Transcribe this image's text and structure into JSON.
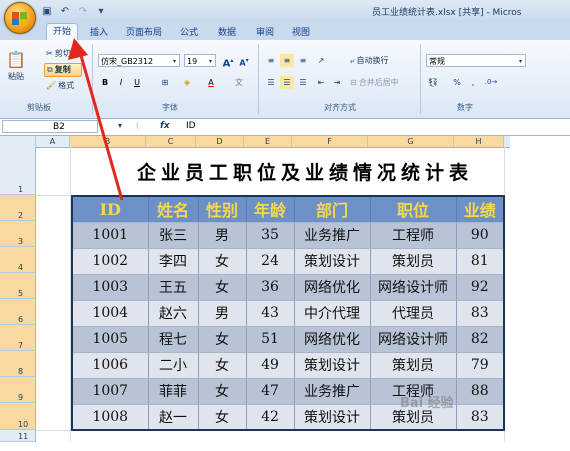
{
  "window": {
    "title": "员工业绩统计表.xlsx [共享] - Micros"
  },
  "tabs": [
    "开始",
    "插入",
    "页面布局",
    "公式",
    "数据",
    "审阅",
    "视图"
  ],
  "ribbon": {
    "clipboard": {
      "paste": "粘贴",
      "cut": "剪切",
      "copy": "复制",
      "format_painter": "格式",
      "group_label": "剪贴板"
    },
    "font": {
      "font_name": "仿宋_GB2312",
      "font_size": "19",
      "grow": "A",
      "shrink": "A",
      "bold": "B",
      "italic": "I",
      "underline": "U",
      "group_label": "字体"
    },
    "alignment": {
      "wrap_text": "自动换行",
      "merge_center": "合并后居中",
      "group_label": "对齐方式"
    },
    "number": {
      "format": "常规",
      "percent": "%",
      "comma": ",",
      "group_label": "数字"
    }
  },
  "formula_bar": {
    "name_box": "B2",
    "fx": "fx",
    "content": "ID"
  },
  "columns": [
    "A",
    "B",
    "C",
    "D",
    "E",
    "F",
    "G",
    "H"
  ],
  "rows": [
    "1",
    "2",
    "3",
    "4",
    "5",
    "6",
    "7",
    "8",
    "9",
    "10",
    "11"
  ],
  "sheet": {
    "title": "企业员工职位及业绩情况统计表",
    "headers": [
      "ID",
      "姓名",
      "性别",
      "年龄",
      "部门",
      "职位",
      "业绩"
    ],
    "data": [
      [
        "1001",
        "张三",
        "男",
        "35",
        "业务推广",
        "工程师",
        "90"
      ],
      [
        "1002",
        "李四",
        "女",
        "24",
        "策划设计",
        "策划员",
        "81"
      ],
      [
        "1003",
        "王五",
        "女",
        "36",
        "网络优化",
        "网络设计师",
        "92"
      ],
      [
        "1004",
        "赵六",
        "男",
        "43",
        "中介代理",
        "代理员",
        "83"
      ],
      [
        "1005",
        "程七",
        "女",
        "51",
        "网络优化",
        "网络设计师",
        "82"
      ],
      [
        "1006",
        "二小",
        "女",
        "49",
        "策划设计",
        "策划员",
        "79"
      ],
      [
        "1007",
        "菲菲",
        "女",
        "47",
        "业务推广",
        "工程师",
        "88"
      ],
      [
        "1008",
        "赵一",
        "女",
        "42",
        "策划设计",
        "策划员",
        "83"
      ]
    ]
  },
  "watermark": "Bai 经验",
  "colors": {
    "header_bg": "#6d91c6",
    "header_text": "#f7d84a",
    "row_odd": "#b8c4d6",
    "row_even": "#dfe4ed",
    "arrow": "#e0281c"
  }
}
